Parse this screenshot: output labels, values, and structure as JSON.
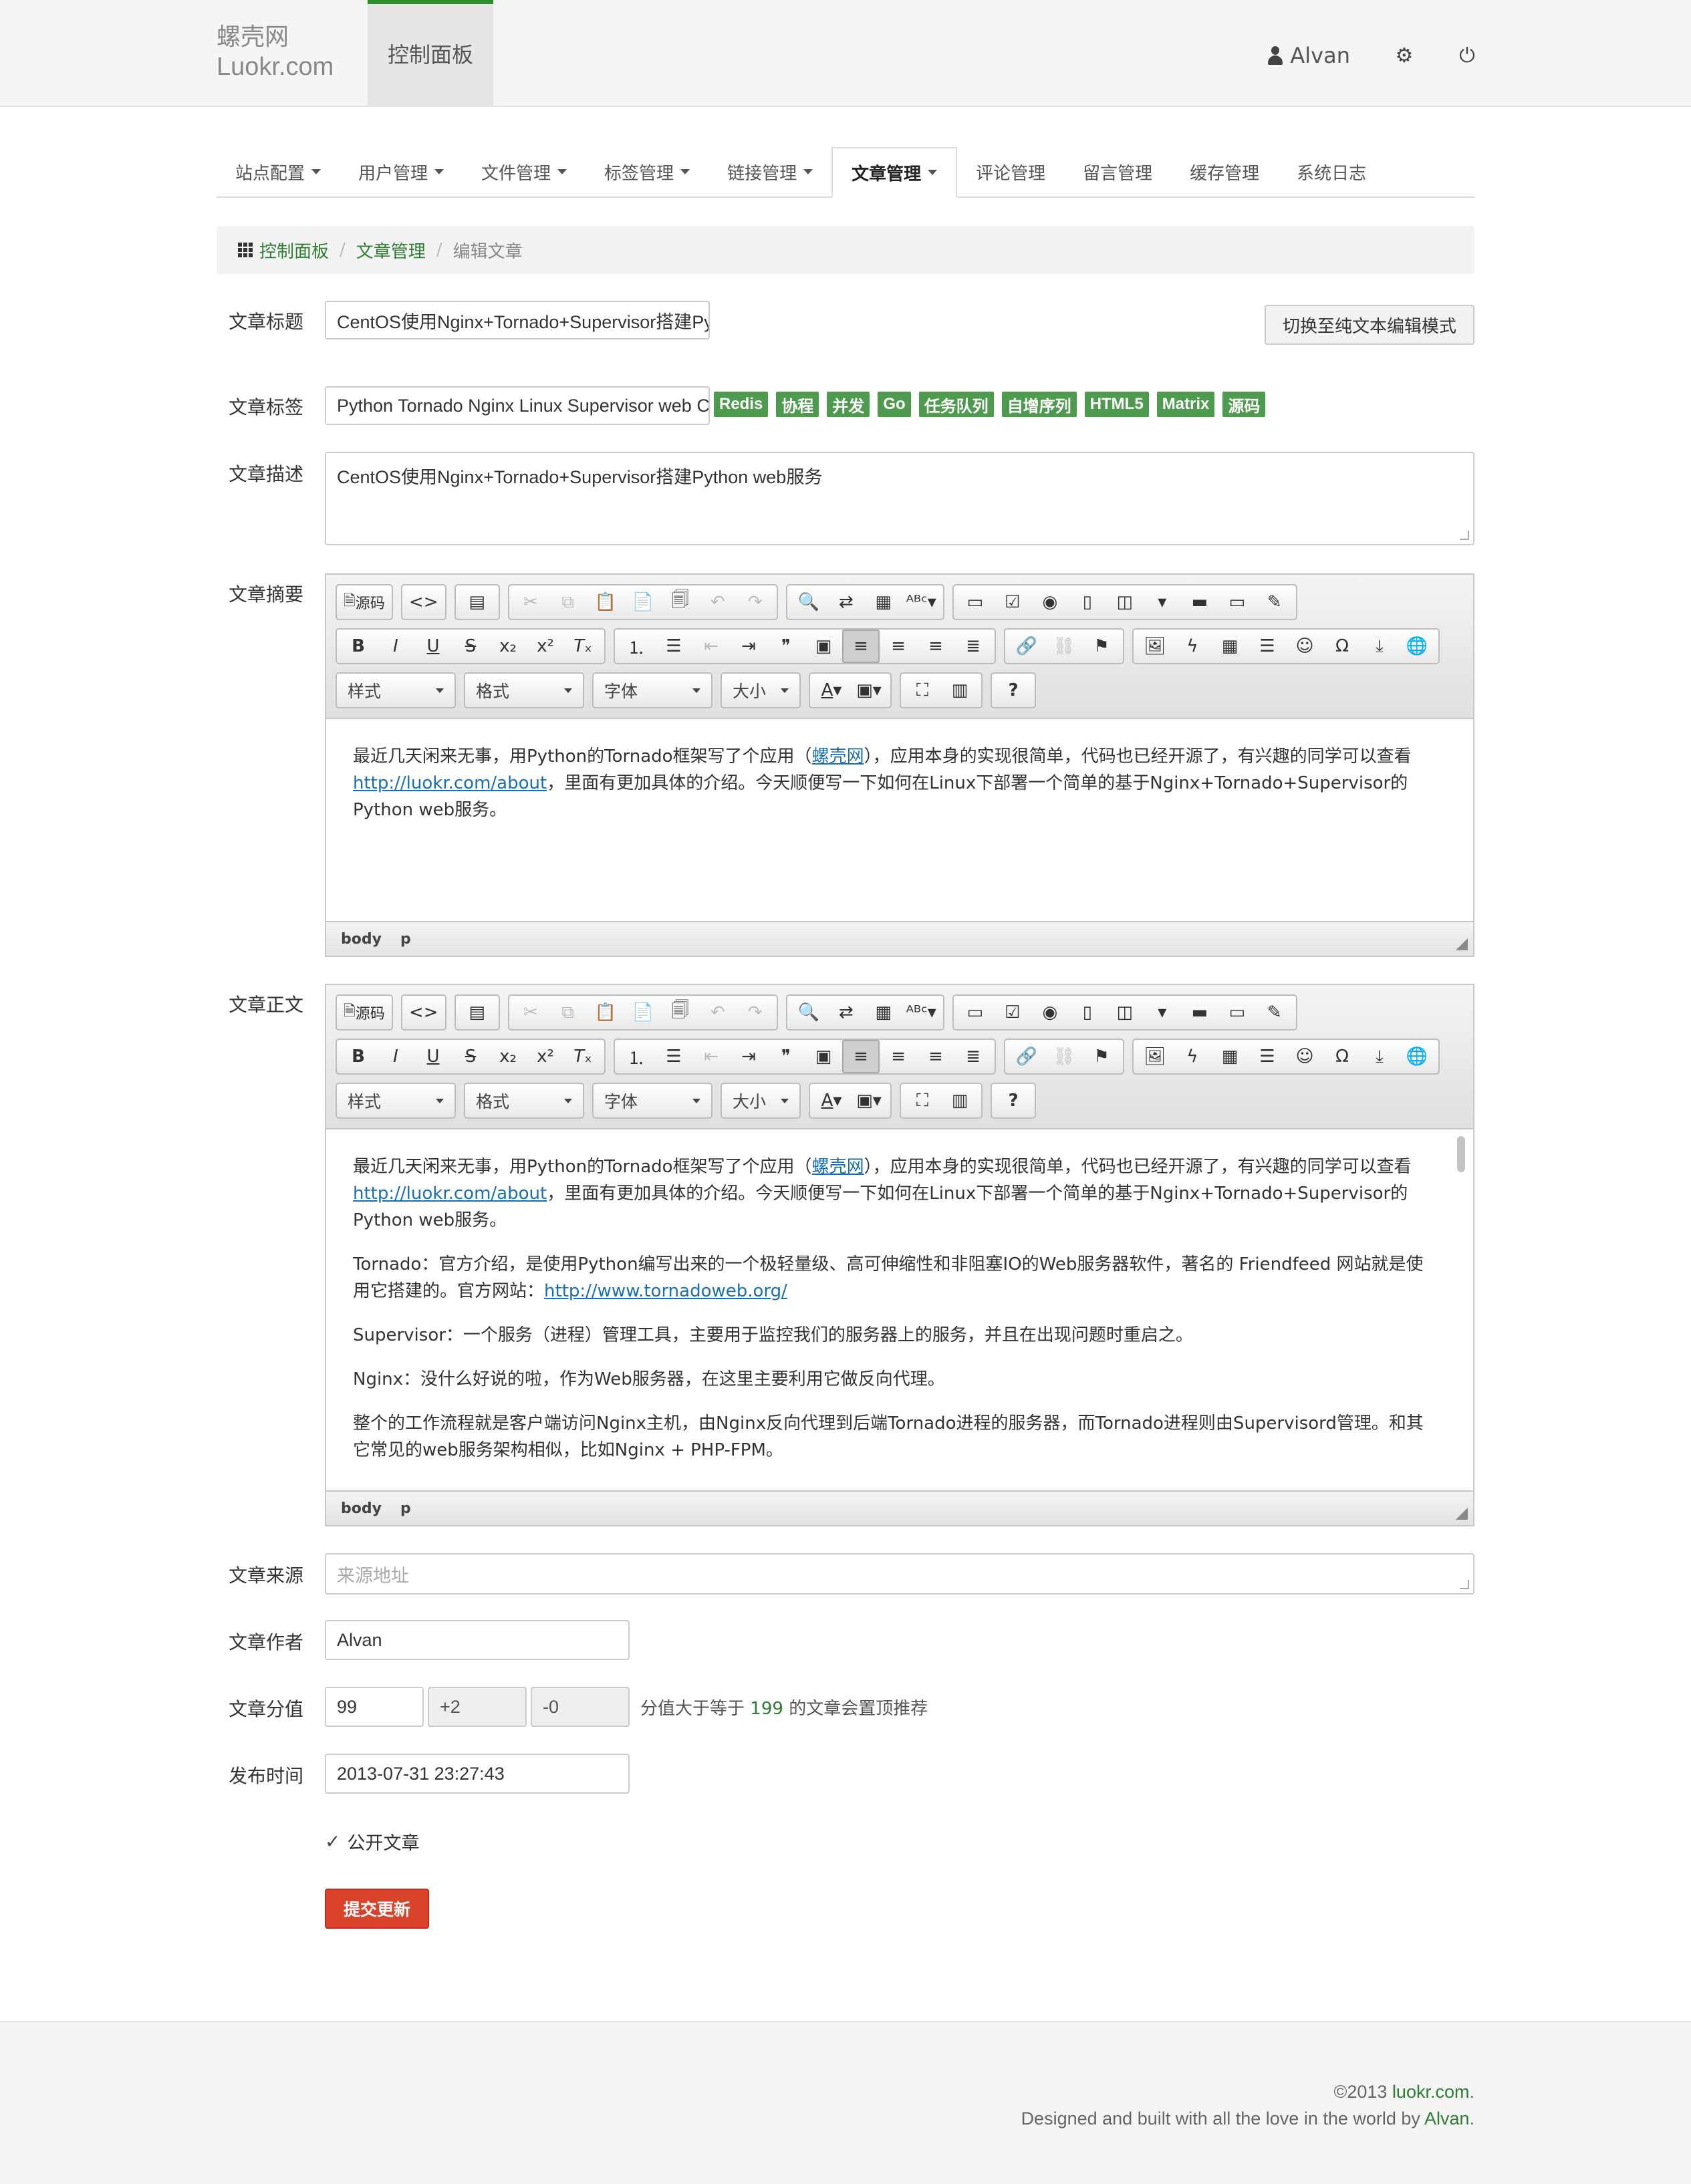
{
  "header": {
    "brand_cn": "螺壳网",
    "brand_en": "Luokr.com",
    "dashboard": "控制面板",
    "user": "Alvan"
  },
  "tabs": [
    {
      "label": "站点配置",
      "dropdown": true,
      "active": false
    },
    {
      "label": "用户管理",
      "dropdown": true,
      "active": false
    },
    {
      "label": "文件管理",
      "dropdown": true,
      "active": false
    },
    {
      "label": "标签管理",
      "dropdown": true,
      "active": false
    },
    {
      "label": "链接管理",
      "dropdown": true,
      "active": false
    },
    {
      "label": "文章管理",
      "dropdown": true,
      "active": true
    },
    {
      "label": "评论管理",
      "dropdown": false,
      "active": false
    },
    {
      "label": "留言管理",
      "dropdown": false,
      "active": false
    },
    {
      "label": "缓存管理",
      "dropdown": false,
      "active": false
    },
    {
      "label": "系统日志",
      "dropdown": false,
      "active": false
    }
  ],
  "breadcrumb": {
    "home": "控制面板",
    "section": "文章管理",
    "current": "编辑文章"
  },
  "form": {
    "title_label": "文章标题",
    "title_value": "CentOS使用Nginx+Tornado+Supervisor搭建Py",
    "switch_mode_button": "切换至纯文本编辑模式",
    "tags_label": "文章标签",
    "tags_value": "Python Tornado Nginx Linux Supervisor web C",
    "tag_suggestions": [
      "Redis",
      "协程",
      "并发",
      "Go",
      "任务队列",
      "自增序列",
      "HTML5",
      "Matrix",
      "源码"
    ],
    "desc_label": "文章描述",
    "desc_value": "CentOS使用Nginx+Tornado+Supervisor搭建Python web服务",
    "summary_label": "文章摘要",
    "body_label": "文章正文",
    "source_label": "文章来源",
    "source_placeholder": "来源地址",
    "author_label": "文章作者",
    "author_value": "Alvan",
    "score_label": "文章分值",
    "score_value": "99",
    "score_up": "+2",
    "score_down": "-0",
    "score_hint_prefix": "分值大于等于",
    "score_hint_number": "199",
    "score_hint_suffix": "的文章会置顶推荐",
    "time_label": "发布时间",
    "time_value": "2013-07-31 23:27:43",
    "public_label": "公开文章",
    "submit": "提交更新"
  },
  "editor": {
    "source_btn": "源码",
    "combo_style": "样式",
    "combo_format": "格式",
    "combo_font": "字体",
    "combo_size": "大小",
    "path_body": "body",
    "path_p": "p"
  },
  "summary_content": {
    "p1_a": "最近几天闲来无事，用Python的Tornado框架写了个应用（",
    "p1_link": "螺壳网",
    "p1_b": "），应用本身的实现很简单，代码也已经开源了，有兴趣的同学可以查看",
    "p1_url": "http://luokr.com/about",
    "p1_c": "，里面有更加具体的介绍。今天顺便写一下如何在Linux下部署一个简单的基于Nginx+Tornado+Supervisor的Python web服务。"
  },
  "body_content": {
    "p1_a": "最近几天闲来无事，用Python的Tornado框架写了个应用（",
    "p1_link": "螺壳网",
    "p1_b": "），应用本身的实现很简单，代码也已经开源了，有兴趣的同学可以查看",
    "p1_url": "http://luokr.com/about",
    "p1_c": "，里面有更加具体的介绍。今天顺便写一下如何在Linux下部署一个简单的基于Nginx+Tornado+Supervisor的Python web服务。",
    "p2_a": "Tornado：官方介绍，是使用Python编写出来的一个极轻量级、高可伸缩性和非阻塞IO的Web服务器软件，著名的 Friendfeed 网站就是使用它搭建的。官方网站：",
    "p2_url": "http://www.tornadoweb.org/",
    "p3": "Supervisor：一个服务（进程）管理工具，主要用于监控我们的服务器上的服务，并且在出现问题时重启之。",
    "p4": "Nginx：没什么好说的啦，作为Web服务器，在这里主要利用它做反向代理。",
    "p5": "整个的工作流程就是客户端访问Nginx主机，由Nginx反向代理到后端Tornado进程的服务器，而Tornado进程则由Supervisord管理。和其它常见的web服务架构相似，比如Nginx + PHP-FPM。"
  },
  "footer": {
    "copyright": "©2013",
    "site": "luokr.com",
    "line2_prefix": "Designed and built with all the love in the world by",
    "author": "Alvan"
  },
  "colors": {
    "accent": "#2e7d32",
    "tag": "#4e9a4e",
    "submit": "#d9432b",
    "link": "#1a6fb0"
  }
}
